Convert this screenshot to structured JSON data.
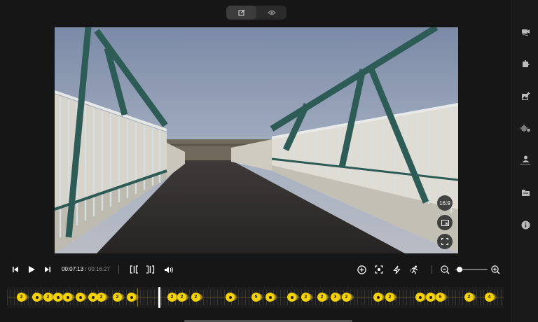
{
  "mode_toggle": {
    "edit_icon": "edit-icon",
    "preview_icon": "eye-icon"
  },
  "right_rail": {
    "items": [
      {
        "name": "video-camera-icon"
      },
      {
        "name": "plugin-icon"
      },
      {
        "name": "add-media-icon"
      },
      {
        "name": "audio-settings-icon"
      },
      {
        "name": "account-icon",
        "label": "Account"
      },
      {
        "name": "folder-icon"
      },
      {
        "name": "info-icon"
      }
    ]
  },
  "video": {
    "aspect_label": "16:9"
  },
  "player": {
    "current_time": "00:07:13",
    "separator": "/",
    "duration": "00:16:27",
    "zoom_level": 0.05
  },
  "timeline": {
    "markers": [
      "2",
      "",
      "2",
      "",
      "",
      "",
      "",
      "2",
      "2",
      "",
      "2",
      "2",
      "2",
      "",
      "5",
      "",
      "",
      "2",
      "2",
      "3",
      "2",
      "",
      "2",
      "",
      "",
      "6",
      "2",
      "4"
    ]
  },
  "colors": {
    "marker": "#f5d20a",
    "background": "#161616"
  }
}
